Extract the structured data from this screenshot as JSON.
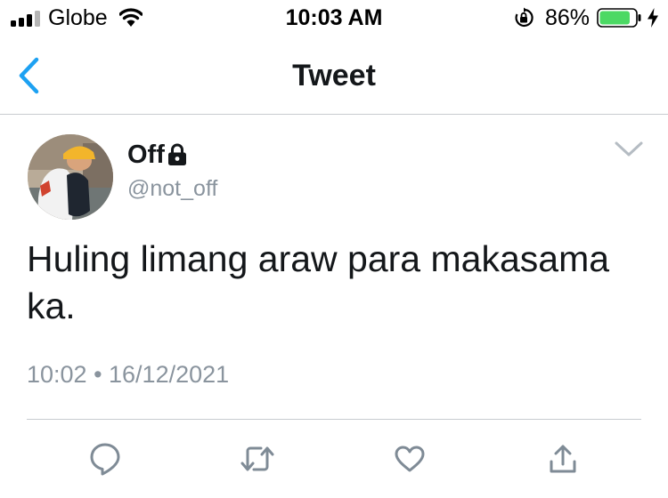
{
  "status_bar": {
    "carrier": "Globe",
    "time": "10:03 AM",
    "battery_percent": "86%",
    "battery_level": 0.86,
    "battery_color": "#4cd964",
    "icons": [
      "signal-icon",
      "wifi-icon",
      "rotation-lock-icon",
      "battery-icon",
      "charging-bolt-icon"
    ]
  },
  "nav": {
    "title": "Tweet",
    "back_icon": "chevron-left-icon",
    "accent_color": "#1da1f2"
  },
  "tweet": {
    "display_name": "Off",
    "protected_icon": "lock-icon",
    "handle": "@not_off",
    "text": "Huling limang araw para makasama ka.",
    "timestamp": "10:02 • 16/12/2021",
    "menu_icon": "chevron-down-icon"
  },
  "actions": [
    {
      "name": "reply",
      "icon": "reply-icon"
    },
    {
      "name": "retweet",
      "icon": "retweet-icon"
    },
    {
      "name": "like",
      "icon": "heart-icon"
    },
    {
      "name": "share",
      "icon": "share-icon"
    }
  ],
  "colors": {
    "text_primary": "#14171a",
    "text_secondary": "#8a949e",
    "icon_gray": "#7f8b96",
    "divider": "#c8ccd0"
  }
}
